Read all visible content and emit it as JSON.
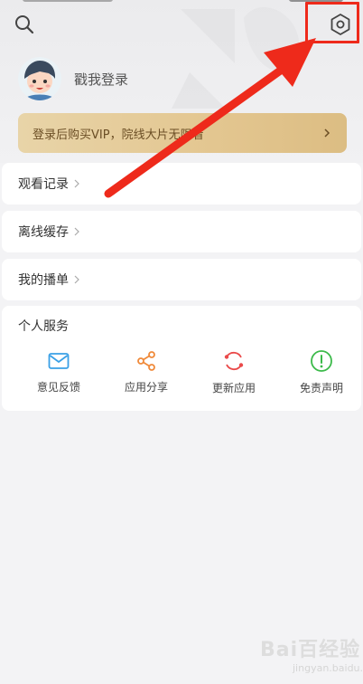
{
  "header": {
    "search_icon": "search-icon",
    "settings_icon": "settings-hexagon-icon",
    "highlight_color": "#ee2a1b"
  },
  "profile": {
    "avatar_icon": "cartoon-avatar",
    "login_text": "戳我登录"
  },
  "vip_banner": {
    "text": "登录后购买VIP，院线大片无限看",
    "color": "#e3c690"
  },
  "menu": [
    {
      "label": "观看记录"
    },
    {
      "label": "离线缓存"
    },
    {
      "label": "我的播单"
    }
  ],
  "services": {
    "title": "个人服务",
    "items": [
      {
        "label": "意见反馈",
        "icon": "mail-icon",
        "color": "#3aa0e6"
      },
      {
        "label": "应用分享",
        "icon": "share-icon",
        "color": "#f08a3a"
      },
      {
        "label": "更新应用",
        "icon": "refresh-icon",
        "color": "#ea4a4a"
      },
      {
        "label": "免责声明",
        "icon": "alert-circle-icon",
        "color": "#3cba4a"
      }
    ]
  },
  "watermark": {
    "text": "Bai百经验",
    "sub": "jingyan.baidu.com"
  },
  "annotation": {
    "arrow_color": "#ee2a1b"
  }
}
